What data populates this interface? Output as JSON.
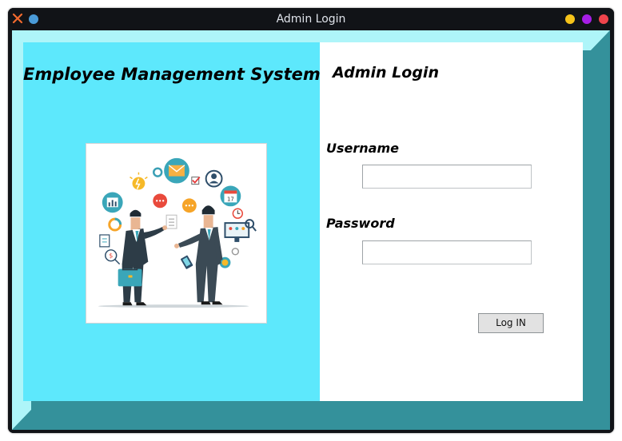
{
  "window": {
    "title": "Admin Login",
    "controls": {
      "close_icon": "close-x-icon",
      "menu_icon": "blue-dot-icon",
      "right_dots": [
        {
          "name": "minimize-dot",
          "color": "#f5c31a"
        },
        {
          "name": "maximize-dot",
          "color": "#a61ee6"
        },
        {
          "name": "close-dot",
          "color": "#f0444c"
        }
      ]
    }
  },
  "left_panel": {
    "heading": "Employee Management System",
    "background": "#5de8fc",
    "illustration": "business-people-handshake-illustration"
  },
  "form": {
    "heading": "Admin Login",
    "username_label": "Username",
    "username_value": "",
    "password_label": "Password",
    "password_value": "",
    "login_button": "Log IN"
  },
  "colors": {
    "frame_dark": "#34919b",
    "frame_light": "#aef5f9",
    "accent_cyan": "#5de8fc"
  }
}
